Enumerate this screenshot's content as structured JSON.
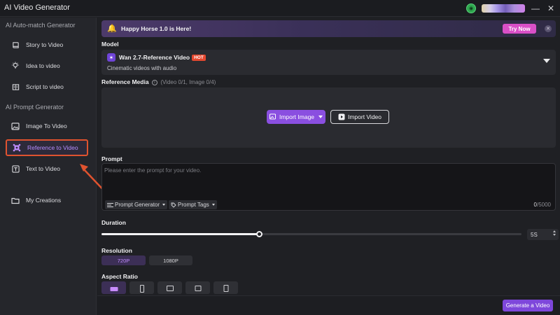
{
  "window": {
    "title": "AI Video Generator"
  },
  "sidebar": {
    "section_auto": "AI Auto-match Generator",
    "section_prompt": "AI Prompt Generator",
    "items": [
      {
        "label": "Story to Video",
        "icon": "book-icon"
      },
      {
        "label": "Idea to video",
        "icon": "lightbulb-icon"
      },
      {
        "label": "Script to video",
        "icon": "script-icon"
      },
      {
        "label": "Image To Video",
        "icon": "image-icon"
      },
      {
        "label": "Reference to Video",
        "icon": "reference-icon",
        "active": true
      },
      {
        "label": "Text to Video",
        "icon": "text-icon"
      },
      {
        "label": "My Creations",
        "icon": "folder-icon"
      }
    ]
  },
  "banner": {
    "text": "Happy Horse 1.0 is Here!",
    "button": "Try Now"
  },
  "model": {
    "label": "Model",
    "name": "Wan 2.7-Reference Video",
    "badge": "HOT",
    "description": "Cinematic videos with audio"
  },
  "reference": {
    "label": "Reference Media",
    "counts": "(Video 0/1, Image 0/4)",
    "import_image": "Import Image",
    "import_video": "Import Video"
  },
  "prompt": {
    "label": "Prompt",
    "placeholder": "Please enter the prompt for your video.",
    "generator": "Prompt Generator",
    "tags": "Prompt Tags",
    "count_current": "0",
    "count_max": "/5000"
  },
  "duration": {
    "label": "Duration",
    "value": "5S",
    "fraction": 0.375
  },
  "resolution": {
    "label": "Resolution",
    "options": [
      "720P",
      "1080P"
    ],
    "selected": "720P"
  },
  "aspect": {
    "label": "Aspect Ratio"
  },
  "footer": {
    "generate": "Generate a Video"
  },
  "colors": {
    "accent": "#8a4fe0",
    "highlight": "#e0532f",
    "try_now": "#d94fc7"
  }
}
